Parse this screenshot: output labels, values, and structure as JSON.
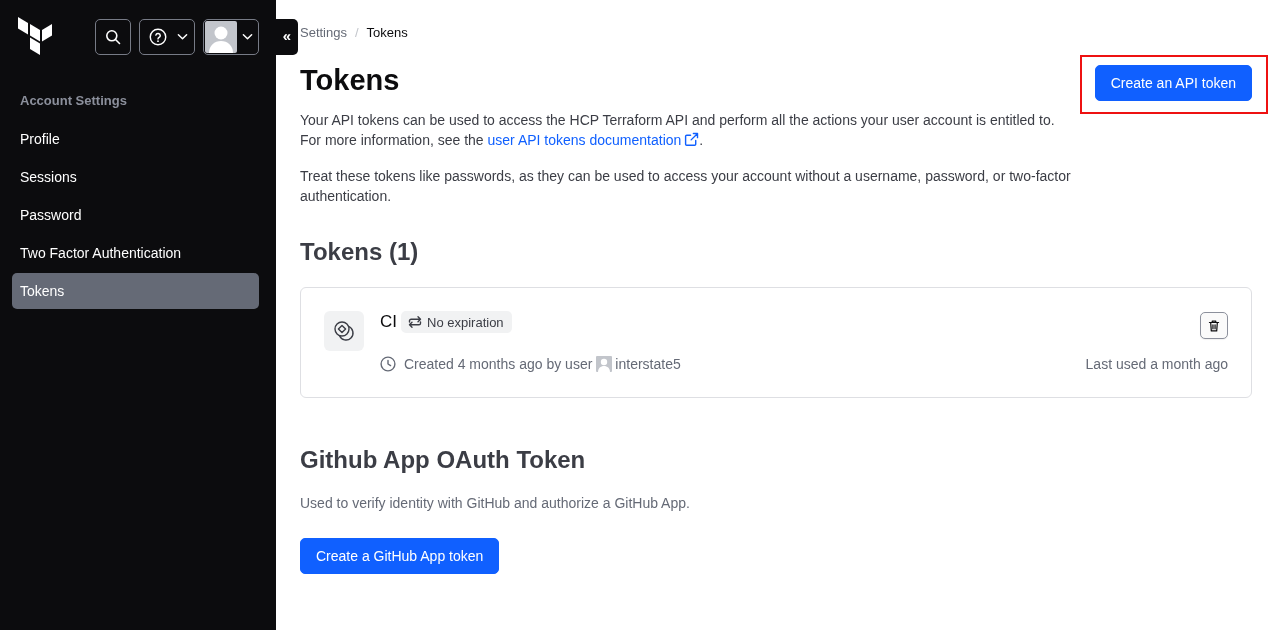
{
  "sidebar": {
    "header_buttons": [
      {
        "kind": "search",
        "dropdown": false
      },
      {
        "kind": "help",
        "dropdown": true
      },
      {
        "kind": "avatar",
        "dropdown": true
      }
    ],
    "section_title": "Account Settings",
    "items": [
      {
        "label": "Profile",
        "selected": false
      },
      {
        "label": "Sessions",
        "selected": false
      },
      {
        "label": "Password",
        "selected": false
      },
      {
        "label": "Two Factor Authentication",
        "selected": false
      },
      {
        "label": "Tokens",
        "selected": true
      }
    ]
  },
  "collapse_toggle": {
    "label": "«"
  },
  "breadcrumb": {
    "items": [
      {
        "label": "Settings",
        "current": false
      },
      {
        "label": "Tokens",
        "current": true
      }
    ],
    "separator": "/"
  },
  "header": {
    "title": "Tokens",
    "intro": {
      "text": "Your API tokens can be used to access the HCP Terraform API and perform all the actions your user account is entitled to. For more information, see the ",
      "link": "user API tokens documentation",
      "after": "."
    },
    "warning": "Treat these tokens like passwords, as they can be used to access your account without a username, password, or two-factor authentication.",
    "action": {
      "label": "Create an API token",
      "highlighted": true
    }
  },
  "tokens_section": {
    "title": "Tokens (1)",
    "tokens": [
      {
        "name": "CI",
        "expiration": "No expiration",
        "created": "Created 4 months ago by user",
        "user": "interstate5",
        "last_used": "Last used a month ago"
      }
    ]
  },
  "github_section": {
    "title": "Github App OAuth Token",
    "description": "Used to verify identity with GitHub and authorize a GitHub App.",
    "action": {
      "label": "Create a GitHub App token"
    }
  }
}
